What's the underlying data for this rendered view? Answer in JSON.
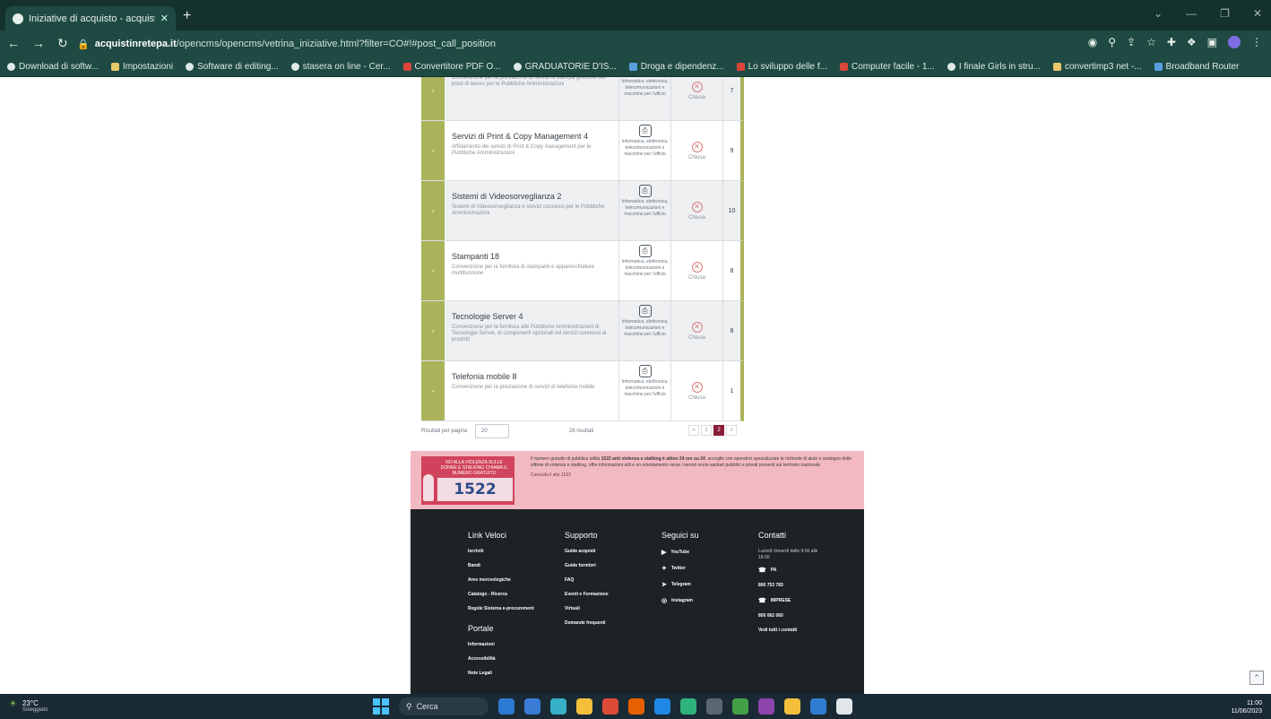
{
  "browser": {
    "tab_title": "Iniziative di acquisto - acquistin...",
    "url_domain": "acquistinretepa.it",
    "url_path": "/opencms/opencms/vetrina_iniziative.html?filter=CO#!#post_call_position",
    "bookmarks": [
      "Download di softw...",
      "Impostazioni",
      "Software di editing...",
      "stasera on line - Cer...",
      "Convertitore PDF O...",
      "GRADUATORIE D'IS...",
      "Droga e dipendenz...",
      "Lo sviluppo delle f...",
      "Computer facile - 1...",
      "I finale Girls in stru...",
      "convertimp3 net -...",
      "Broadband Router"
    ]
  },
  "rows": [
    {
      "title": "",
      "desc": "Convenzione per la prestazione di servizi di stampa gestione dei posti di lavoro per le Pubbliche Amministrazioni",
      "area": "Informatica, elettronica, telecomunicazioni e macchine per l'ufficio",
      "status": "Chiusa",
      "count": "7"
    },
    {
      "title": "Servizi di Print & Copy Management 4",
      "desc": "Affidamento dei servizi di Print & Copy management per le Pubbliche Amministrazioni",
      "area": "Informatica, elettronica, telecomunicazioni e macchine per l'ufficio",
      "status": "Chiusa",
      "count": "9"
    },
    {
      "title": "Sistemi di Videosorveglianza 2",
      "desc": "Sistemi di Videosorveglianza e servizi connessi per le Pubbliche Amministrazioni",
      "area": "Informatica, elettronica, telecomunicazioni e macchine per l'ufficio",
      "status": "Chiusa",
      "count": "10"
    },
    {
      "title": "Stampanti 18",
      "desc": "Convenzione per la fornitura di stampanti e apparecchiature multifunzione",
      "area": "Informatica, elettronica, telecomunicazioni e macchine per l'ufficio",
      "status": "Chiusa",
      "count": "8"
    },
    {
      "title": "Tecnologie Server 4",
      "desc": "Convenzione per la fornitura alle Pubbliche Amministrazioni di Tecnologie Server, di componenti opzionali ed servizi connessi ai prodotti",
      "area": "Informatica, elettronica, telecomunicazioni e macchine per l'ufficio",
      "status": "Chiusa",
      "count": "8"
    },
    {
      "title": "Telefonia mobile 8",
      "desc": "Convenzione per la prestazione di servizi di telefonia mobile",
      "area": "Informatica, elettronica, telecomunicazioni e macchine per l'ufficio",
      "status": "Chiusa",
      "count": "1"
    }
  ],
  "pager": {
    "label": "Risultati per pagina",
    "select_value": "20",
    "results": "26 risultati",
    "pages": [
      "«",
      "1",
      "2",
      "»"
    ],
    "current": "2"
  },
  "banner": {
    "badge_text": "NO ALLA VIOLENZA SULLE DONNE E STALKING CHIAMA IL NUMERO GRATUITO",
    "number": "1522",
    "text_pre": "Il numero gratuito di pubblica utilità ",
    "text_bold": "1522 anti violenza e stalking è attivo 24 ore su 24",
    "text_post": ", accoglie con operatrici specializzate le richieste di aiuto e sostegno delle vittime di violenza e stalking, offre informazioni utili e un orientamento verso i servizi socio-sanitari pubblici e privati presenti sul territorio nazionale.",
    "more": "Consulta il sito 1522"
  },
  "footer": {
    "links_title": "Link Veloci",
    "links": [
      "Iscriviti",
      "Bandi",
      "Aree merceologiche",
      "Catalogo - Ricerca",
      "Regole Sistema e-procurement"
    ],
    "portal_title": "Portale",
    "portal_links": [
      "Informazioni",
      "Accessibilità",
      "Note Legali"
    ],
    "support_title": "Supporto",
    "support_links": [
      "Guide acquisti",
      "Guide fornitori",
      "FAQ",
      "Eventi e Formazione",
      "Virtuali",
      "Domande frequenti"
    ],
    "social_title": "Seguici su",
    "social": [
      {
        "icon": "youtube-icon",
        "label": "YouTube"
      },
      {
        "icon": "twitter-icon",
        "label": "Twitter"
      },
      {
        "icon": "telegram-icon",
        "label": "Telegram"
      },
      {
        "icon": "instagram-icon",
        "label": "Instagram"
      }
    ],
    "contact_title": "Contatti",
    "contact_hours": "Lunedì-Venerdì dalle 9:00 alle 18:00",
    "contact_pa": "PA",
    "contact_pa_number": "800 753 783",
    "contact_imprese": "IMPRESE",
    "contact_imprese_number": "800 062 060",
    "contact_more": "Vedi tutti i contatti"
  },
  "taskbar": {
    "temp": "23°C",
    "weather": "Soleggiato",
    "search": "Cerca",
    "time": "11:00",
    "date": "11/06/2023"
  }
}
